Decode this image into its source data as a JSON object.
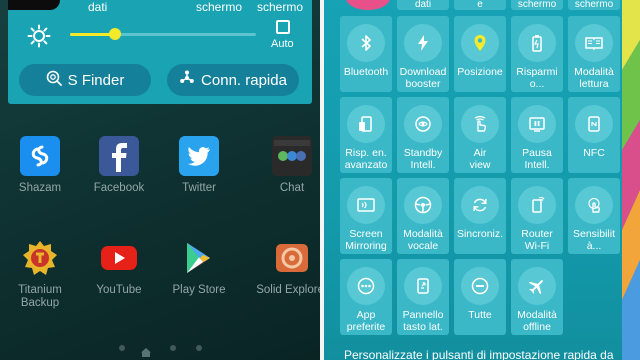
{
  "notification_panel": {
    "top_labels": [
      "dati",
      "schermo",
      "schermo"
    ],
    "auto_label": "Auto",
    "brightness_percent": 24,
    "buttons": {
      "s_finder": "S Finder",
      "conn_rapida": "Conn. rapida"
    }
  },
  "home_screen": {
    "apps": [
      {
        "label": "Shazam",
        "icon": "shazam-icon",
        "color": "#1a8ff0"
      },
      {
        "label": "Facebook",
        "icon": "facebook-icon",
        "color": "#3b5998"
      },
      {
        "label": "Twitter",
        "icon": "twitter-icon",
        "color": "#2aa3ef"
      },
      {
        "label": "Chat",
        "icon": "chat-icon",
        "color": "#5a5a5a"
      },
      {
        "label": "Titanium\nBackup",
        "icon": "titanium-icon",
        "color": "#c8342a"
      },
      {
        "label": "YouTube",
        "icon": "youtube-icon",
        "color": "#e62117"
      },
      {
        "label": "Play Store",
        "icon": "play-store-icon",
        "color": "#ffffff"
      },
      {
        "label": "Solid Explorer",
        "icon": "solid-explorer-icon",
        "color": "#e2542a"
      }
    ]
  },
  "quick_settings": {
    "top_row_labels": [
      "dati",
      "e",
      "schermo",
      "schermo"
    ],
    "tiles": [
      {
        "label": "Bluetooth",
        "icon": "bluetooth-icon",
        "active": false
      },
      {
        "label": "Download\nbooster",
        "icon": "download-booster-icon",
        "active": false
      },
      {
        "label": "Posizione",
        "icon": "location-icon",
        "active": true
      },
      {
        "label": "Risparmi\no...",
        "icon": "battery-saver-icon",
        "active": false
      },
      {
        "label": "Modalità\nlettura",
        "icon": "reading-mode-icon",
        "active": false
      },
      {
        "label": "Risp. en.\navanzato",
        "icon": "ultra-power-saving-icon",
        "active": false
      },
      {
        "label": "Standby\nIntell.",
        "icon": "smart-stay-icon",
        "active": false
      },
      {
        "label": "Air\nview",
        "icon": "air-view-icon",
        "active": false
      },
      {
        "label": "Pausa\nIntell.",
        "icon": "smart-pause-icon",
        "active": false
      },
      {
        "label": "NFC",
        "icon": "nfc-icon",
        "active": false
      },
      {
        "label": "Screen\nMirroring",
        "icon": "screen-mirroring-icon",
        "active": false
      },
      {
        "label": "Modalità\nvocale",
        "icon": "car-mode-icon",
        "active": false
      },
      {
        "label": "Sincroniz.",
        "icon": "sync-icon",
        "active": false
      },
      {
        "label": "Router\nWi-Fi",
        "icon": "wifi-hotspot-icon",
        "active": false
      },
      {
        "label": "Sensibilit\nà...",
        "icon": "touch-sensitivity-icon",
        "active": false
      },
      {
        "label": "App\npreferite",
        "icon": "toolbox-icon",
        "active": false
      },
      {
        "label": "Pannello\ntasto lat.",
        "icon": "side-key-panel-icon",
        "active": false
      },
      {
        "label": "Tutte",
        "icon": "do-not-disturb-icon",
        "active": false
      },
      {
        "label": "Modalità\noffline",
        "icon": "airplane-icon",
        "active": false
      }
    ],
    "footer_text": "Personalizzate i pulsanti di impostazione rapida da"
  },
  "colors": {
    "panel_teal": "#19a3b3",
    "tile_bg": "#3bb8c7",
    "active_location": "#f5ea2a",
    "slider": "#f5ea2a"
  }
}
